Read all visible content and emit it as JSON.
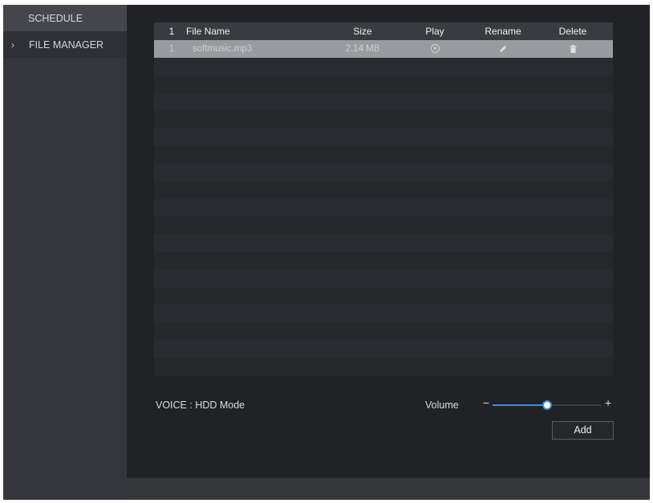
{
  "sidebar": {
    "items": [
      {
        "label": "SCHEDULE"
      },
      {
        "label": "FILE MANAGER",
        "chevron": "›"
      }
    ]
  },
  "table": {
    "headers": {
      "index": "1",
      "file_name": "File Name",
      "size": "Size",
      "play": "Play",
      "rename": "Rename",
      "delete": "Delete"
    },
    "rows": [
      {
        "index": "1",
        "file_name": "softmusic.mp3",
        "size": "2.14 MB",
        "play_icon": "play-circle-icon",
        "rename_icon": "pencil-icon",
        "delete_icon": "trash-icon"
      }
    ]
  },
  "footer": {
    "voice_label": "VOICE : HDD Mode",
    "volume_label": "Volume",
    "volume_minus": "−",
    "volume_plus": "+",
    "volume_level": 0.5,
    "add_label": "Add"
  },
  "colors": {
    "accent": "#3d8bd6",
    "background": "#212226",
    "sidebar": "#35363b",
    "selected_row": "#9a9b9f"
  }
}
